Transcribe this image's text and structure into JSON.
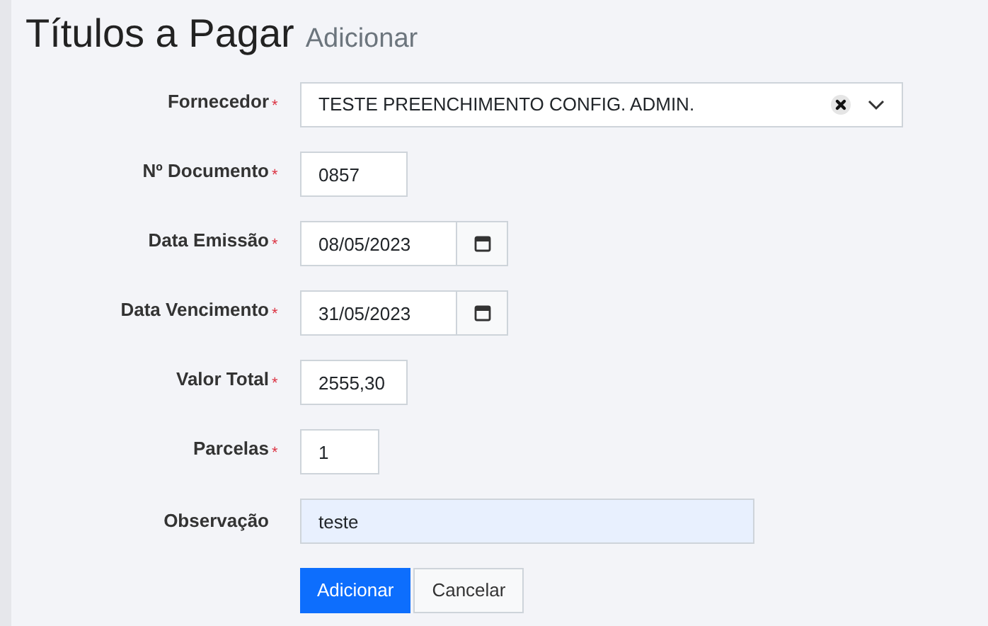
{
  "header": {
    "title": "Títulos a Pagar",
    "subtitle": "Adicionar"
  },
  "fields": [
    {
      "kind": "select",
      "label": "Fornecedor",
      "required_marker": "*",
      "value": "TESTE PREENCHIMENTO CONFIG. ADMIN.",
      "autofilled": false
    },
    {
      "kind": "text",
      "label": "Nº Documento",
      "required_marker": "*",
      "value": "0857",
      "autofilled": false
    },
    {
      "kind": "date",
      "label": "Data Emissão",
      "required_marker": "*",
      "value": "08/05/2023",
      "autofilled": false
    },
    {
      "kind": "date",
      "label": "Data Vencimento",
      "required_marker": "*",
      "value": "31/05/2023",
      "autofilled": false
    },
    {
      "kind": "text",
      "label": "Valor Total",
      "required_marker": "*",
      "value": "2555,30",
      "autofilled": false
    },
    {
      "kind": "short",
      "label": "Parcelas",
      "required_marker": "*",
      "value": "1",
      "autofilled": false
    },
    {
      "kind": "wide",
      "label": "Observação",
      "value": "teste",
      "autofilled": true
    }
  ],
  "buttons": [
    {
      "label": "Adicionar",
      "primary": true
    },
    {
      "label": "Cancelar",
      "primary": false
    }
  ]
}
